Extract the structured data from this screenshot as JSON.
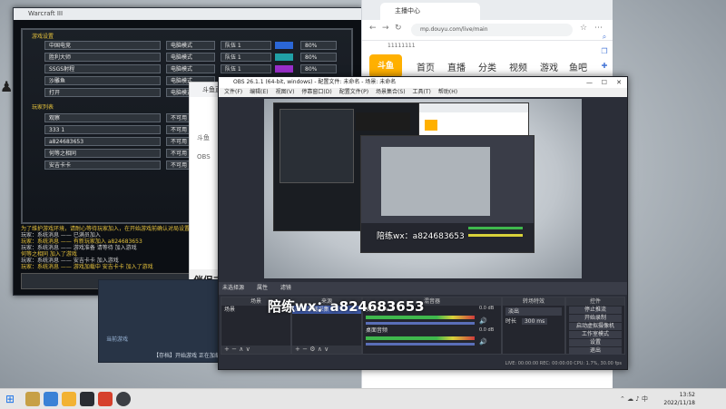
{
  "game": {
    "title": "Warcraft III",
    "section_a": "游戏设置",
    "section_b": "玩家列表",
    "players": [
      {
        "name": "中国电竞",
        "mode": "电脑模式",
        "team": "队伍 1",
        "pct": "80%",
        "color": "#2b67d6"
      },
      {
        "name": "胜利大师",
        "mode": "电脑模式",
        "team": "队伍 1",
        "pct": "80%",
        "color": "#21a0a6"
      },
      {
        "name": "SSGS射程",
        "mode": "电脑模式",
        "team": "队伍 1",
        "pct": "80%",
        "color": "#9a2ecb"
      },
      {
        "name": "沙雕鱼",
        "mode": "电脑模式",
        "team": "队伍 1",
        "pct": "80%",
        "color": "#d6c921"
      },
      {
        "name": "打开",
        "mode": "电脑模式",
        "team": "队伍 1",
        "pct": "80%",
        "color": "#e0782a"
      }
    ],
    "open_slots": [
      {
        "name": "观察",
        "state": "不可用"
      },
      {
        "name": "333 1",
        "state": "不可用"
      },
      {
        "name": "a824683653",
        "state": "不可用"
      },
      {
        "name": "何等之相同",
        "state": "不可用"
      },
      {
        "name": "安吉卡卡",
        "state": "不可用"
      }
    ],
    "chat": [
      "为了维护游戏环境，请耐心等待玩家加入，在开始游戏前确认对局设置",
      "玩家：系统消息 —— 已满员加入",
      "玩家：系统消息 —— 有新玩家加入 a824683653",
      "玩家：系统消息 —— 游戏准备 请等待 加入游戏",
      "何等之相同 加入了游戏",
      "玩家：系统消息 —— 安吉卡卡 加入游戏",
      "玩家：系统消息 —— 游戏加载中 安吉卡卡 加入了游戏"
    ]
  },
  "mid": {
    "header": "斗鱼直",
    "row1": "斗鱼",
    "row2": "OBS",
    "banner_title": "伴侣支",
    "banner_btn": "Bi"
  },
  "stream": {
    "label": "当前游戏",
    "caption": "【存档】开始游戏 正在加载"
  },
  "browser": {
    "tab_title": "主播中心",
    "url": "mp.douyu.com/live/main",
    "bookmark": "11111111",
    "logo": "斗鱼",
    "menu": [
      "首页",
      "直播",
      "分类",
      "视频",
      "游戏",
      "鱼吧"
    ]
  },
  "obs": {
    "title": "OBS 26.1.1 (64-bit, windows) - 配置文件: 未命名 - 场景: 未命名",
    "menu": [
      "文件(F)",
      "编辑(E)",
      "视图(V)",
      "停靠窗口(D)",
      "配置文件(P)",
      "场景集合(S)",
      "工具(T)",
      "帮助(H)"
    ],
    "scene_bar": [
      "未选择源",
      "属性",
      "滤镜"
    ],
    "docks": {
      "scenes": {
        "title": "场景",
        "items": [
          "场景"
        ]
      },
      "sources": {
        "title": "来源",
        "items": [
          "显示器采集"
        ]
      },
      "mixer": {
        "title": "混音器",
        "tracks": [
          "麦克风/Aux",
          "桌面音频"
        ],
        "db": "0.0 dB"
      },
      "transitions": {
        "title": "转场特效",
        "type": "淡出",
        "duration_label": "时长",
        "duration": "300 ms"
      },
      "controls": {
        "title": "控件",
        "buttons": [
          "停止推流",
          "开始录制",
          "启动虚拟摄像机",
          "工作室模式",
          "设置",
          "退出"
        ]
      }
    },
    "status": "LIVE: 00:00:00   REC: 00:00:00   CPU: 1.7%, 30.00 fps",
    "overlay": "陪练wx：a824683653"
  },
  "taskbar": {
    "time": "13:52",
    "date": "2022/11/18"
  }
}
